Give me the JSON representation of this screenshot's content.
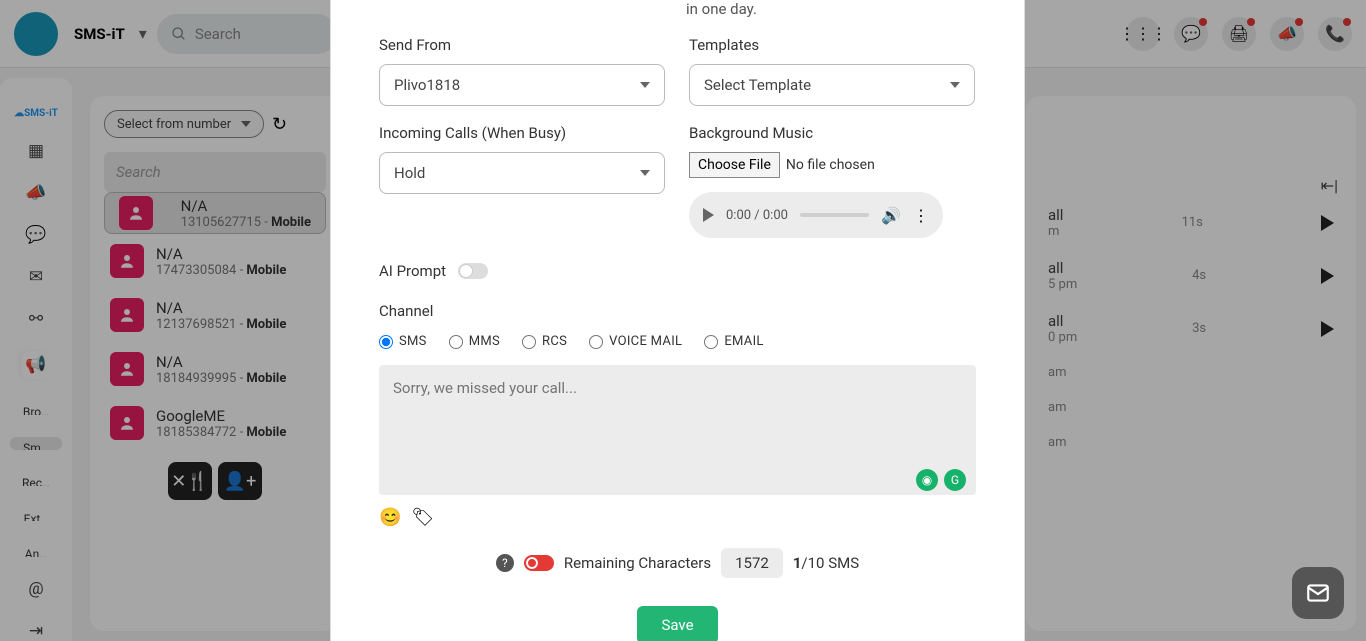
{
  "brand": "SMS-iT",
  "top_search_placeholder": "Search",
  "top_icons": [
    "apps-icon",
    "chat-icon",
    "print-icon",
    "megaphone-icon",
    "phone-icon"
  ],
  "sidebar_logo": "SMS-iT",
  "sidebar_icons": [
    "grid-icon",
    "megaphone-icon",
    "chat-bubble-icon",
    "mail-icon",
    "share-icon",
    "campaign-active-icon"
  ],
  "sidebar_items": [
    "Bro…",
    "Sm…",
    "Rec…",
    "Ext…",
    "An…"
  ],
  "sidebar_active_index": 1,
  "contacts": {
    "select_label": "Select from number",
    "search_placeholder": "Search",
    "refresh_icon": "refresh-icon",
    "list": [
      {
        "name": "N/A",
        "phone": "13105627715",
        "type": "Mobile",
        "selected": true
      },
      {
        "name": "N/A",
        "phone": "17473305084",
        "type": "Mobile"
      },
      {
        "name": "N/A",
        "phone": "12137698521",
        "type": "Mobile"
      },
      {
        "name": "N/A",
        "phone": "18184939995",
        "type": "Mobile"
      },
      {
        "name": "GoogleME",
        "phone": "18185384772",
        "type": "Mobile"
      }
    ]
  },
  "right": {
    "collapse_icon": "collapse-icon",
    "rows": [
      {
        "title_suffix": "all",
        "dur": "11s",
        "time_suffix": "m"
      },
      {
        "title_suffix": "all",
        "dur": "4s",
        "time_suffix": "5 pm"
      },
      {
        "title_suffix": "all",
        "dur": "3s",
        "time_suffix": "0 pm"
      },
      {
        "title_suffix": "",
        "dur": "",
        "time_suffix": "am"
      },
      {
        "title_suffix": "",
        "dur": "",
        "time_suffix": "am"
      },
      {
        "title_suffix": "",
        "dur": "",
        "time_suffix": "am"
      }
    ]
  },
  "modal": {
    "note_tail": "in one day.",
    "send_from_label": "Send From",
    "send_from_value": "Plivo1818",
    "templates_label": "Templates",
    "templates_value": "Select Template",
    "incoming_label": "Incoming Calls (When Busy)",
    "incoming_value": "Hold",
    "bg_music_label": "Background Music",
    "choose_file": "Choose File",
    "no_file": "No file chosen",
    "audio_time": "0:00 / 0:00",
    "ai_prompt_label": "AI Prompt",
    "channel_label": "Channel",
    "channels": [
      "SMS",
      "MMS",
      "RCS",
      "VOICE MAIL",
      "EMAIL"
    ],
    "channel_selected": 0,
    "textarea_placeholder": "Sorry, we missed your call...",
    "remaining_label": "Remaining Characters",
    "remaining_value": "1572",
    "sms_count": "1",
    "sms_max": "/10 SMS",
    "save": "Save"
  }
}
